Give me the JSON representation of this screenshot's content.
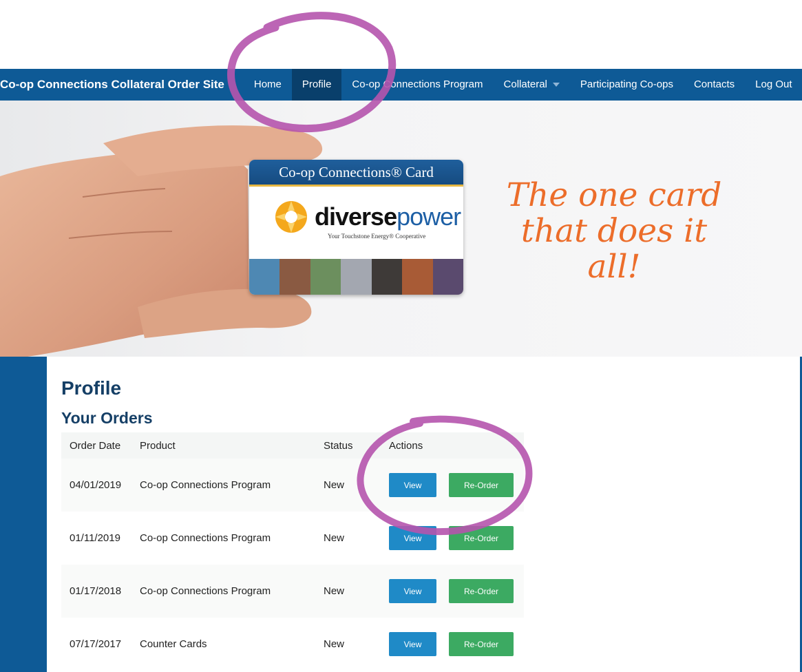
{
  "navbar": {
    "brand": "Co-op Connections Collateral Order Site",
    "items": [
      {
        "label": "Home"
      },
      {
        "label": "Profile"
      },
      {
        "label": "Co-op Connections Program"
      },
      {
        "label": "Collateral"
      },
      {
        "label": "Participating Co-ops"
      },
      {
        "label": "Contacts"
      },
      {
        "label": "Log Out"
      }
    ]
  },
  "hero": {
    "card_title": "Co-op Connections® Card",
    "card_brand_bold": "diverse",
    "card_brand_light": "power",
    "card_tagline": "Your Touchstone Energy® Cooperative",
    "tagline_line1": "The one card",
    "tagline_line2": "that does it all!"
  },
  "page": {
    "title": "Profile",
    "orders_title": "Your Orders"
  },
  "orders": {
    "headers": [
      "Order Date",
      "Product",
      "Status",
      "Actions"
    ],
    "view_label": "View",
    "reorder_label": "Re-Order",
    "rows": [
      {
        "date": "04/01/2019",
        "product": "Co-op Connections Program",
        "status": "New"
      },
      {
        "date": "01/11/2019",
        "product": "Co-op Connections Program",
        "status": "New"
      },
      {
        "date": "01/17/2018",
        "product": "Co-op Connections Program",
        "status": "New"
      },
      {
        "date": "07/17/2017",
        "product": "Counter Cards",
        "status": "New"
      }
    ]
  },
  "colors": {
    "nav_bg": "#0e5a96",
    "nav_active": "#093f6b",
    "view_button": "#1f8ac7",
    "reorder_button": "#3caa62",
    "tagline": "#ec6d2a",
    "annotation": "#b554ad"
  }
}
